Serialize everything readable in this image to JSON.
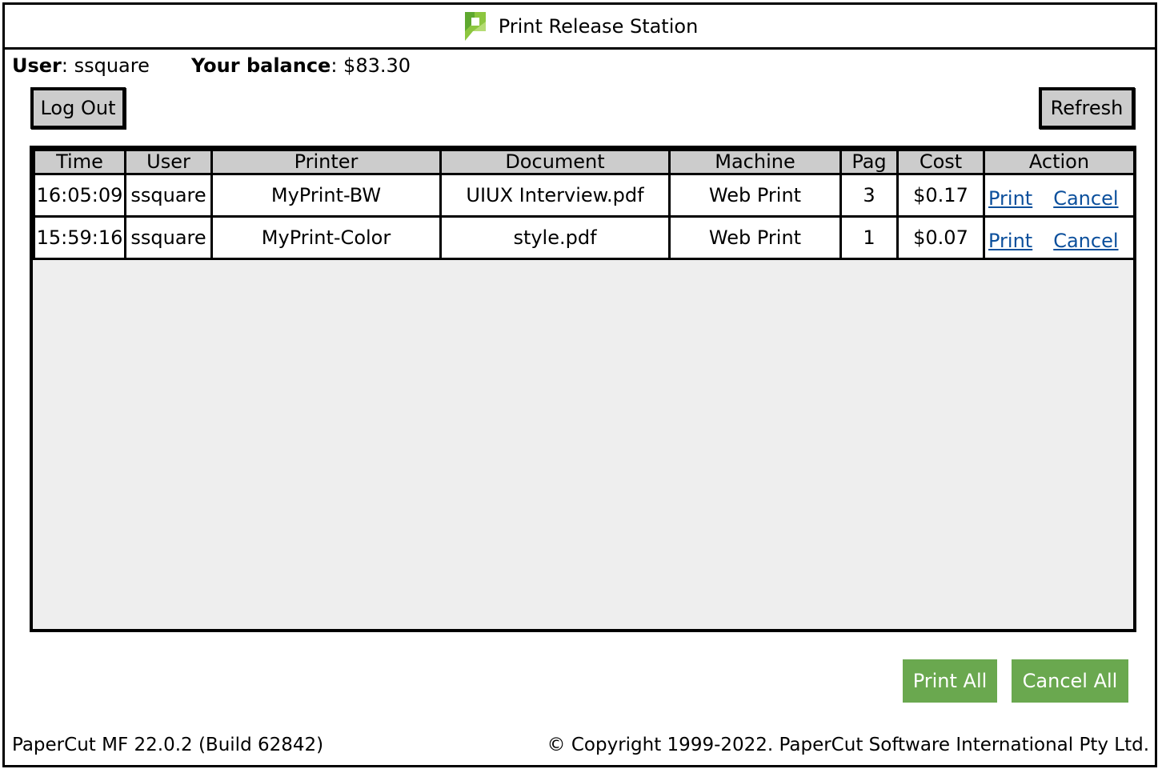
{
  "window": {
    "title": "Print Release Station",
    "logo_icon": "papercut-logo-icon"
  },
  "session": {
    "user_label": "User",
    "user_value": ": ssquare",
    "balance_label": "Your balance",
    "balance_value": ": $83.30"
  },
  "toolbar": {
    "logout_label": "Log Out",
    "refresh_label": "Refresh"
  },
  "table": {
    "headers": [
      "Time",
      "User",
      "Printer",
      "Document",
      "Machine",
      "Pag",
      "Cost",
      "Action"
    ],
    "rows": [
      {
        "time": "16:05:09",
        "user": "ssquare",
        "printer": "MyPrint-BW",
        "document": "UIUX Interview.pdf",
        "machine": "Web Print",
        "pages": "3",
        "cost": "$0.17",
        "print_label": "Print",
        "cancel_label": "Cancel"
      },
      {
        "time": "15:59:16",
        "user": "ssquare",
        "printer": "MyPrint-Color",
        "document": "style.pdf",
        "machine": "Web Print",
        "pages": "1",
        "cost": "$0.07",
        "print_label": "Print",
        "cancel_label": "Cancel"
      }
    ]
  },
  "actions": {
    "print_all_label": "Print All",
    "cancel_all_label": "Cancel All",
    "button_color": "#6aa84f"
  },
  "footer": {
    "version": "PaperCut MF 22.0.2 (Build 62842)",
    "copyright": "© Copyright 1999-2022. PaperCut Software International Pty Ltd."
  },
  "colors": {
    "link": "#0b4f9c",
    "header_bg": "#cccccc",
    "empty_area_bg": "#eeeeee"
  }
}
